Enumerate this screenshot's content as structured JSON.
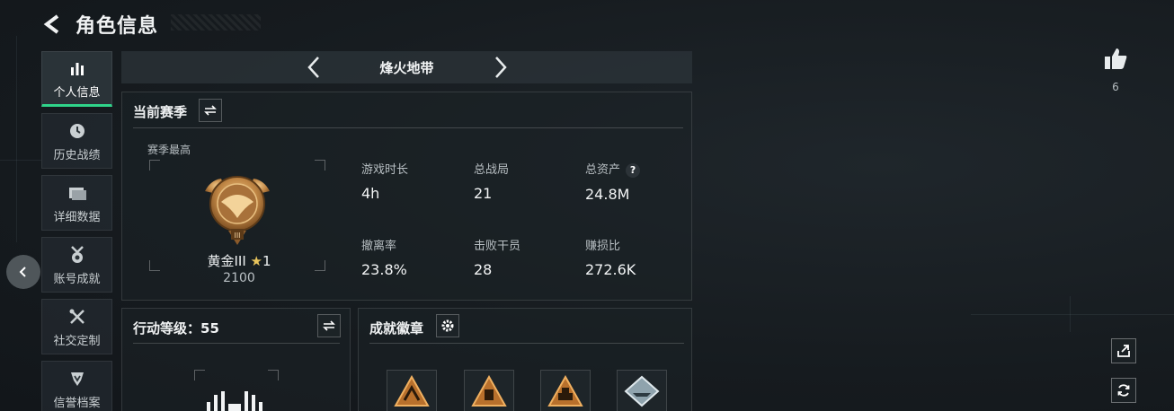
{
  "page": {
    "title": "角色信息"
  },
  "sidebar": {
    "items": [
      {
        "label": "个人信息",
        "icon": "bar-chart-icon",
        "active": true
      },
      {
        "label": "历史战绩",
        "icon": "clock-icon"
      },
      {
        "label": "详细数据",
        "icon": "folder-icon"
      },
      {
        "label": "账号成就",
        "icon": "medal-icon"
      },
      {
        "label": "社交定制",
        "icon": "wrench-icon"
      },
      {
        "label": "信誉档案",
        "icon": "shield-icon"
      }
    ]
  },
  "mode": {
    "name": "烽火地带"
  },
  "season": {
    "title": "当前赛季",
    "subtitle": "赛季最高",
    "rank_name": "黄金III",
    "rank_stars": "1",
    "rank_score": "2100",
    "stats": [
      {
        "label": "游戏时长",
        "value": "4h"
      },
      {
        "label": "总战局",
        "value": "21"
      },
      {
        "label": "总资产",
        "value": "24.8M",
        "help": "?"
      },
      {
        "label": "撤离率",
        "value": "23.8%"
      },
      {
        "label": "击败干员",
        "value": "28"
      },
      {
        "label": "赚损比",
        "value": "272.6K"
      }
    ]
  },
  "action_level": {
    "title": "行动等级：55"
  },
  "achievements": {
    "title": "成就徽章"
  },
  "likes": {
    "count": "6"
  },
  "colors": {
    "accent": "#2fd48a",
    "gold": "#c9944e",
    "background": "#151a1e"
  }
}
